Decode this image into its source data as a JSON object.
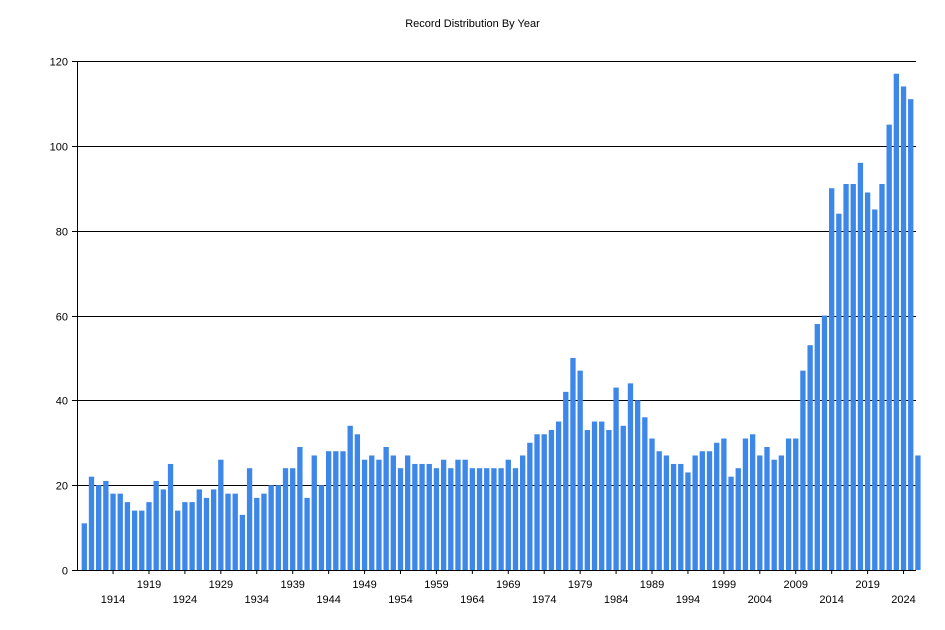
{
  "chart_data": {
    "type": "bar",
    "title": "Record Distribution By Year",
    "xlabel": "",
    "ylabel": "",
    "bar_color": "#3d87e8",
    "grid": "horizontal",
    "ylim": [
      0,
      120
    ],
    "yticks": [
      0,
      20,
      40,
      60,
      80,
      100,
      120
    ],
    "x_first_year": 1910,
    "x_tick_years": [
      1914,
      1919,
      1924,
      1929,
      1934,
      1939,
      1944,
      1949,
      1954,
      1959,
      1964,
      1969,
      1974,
      1979,
      1984,
      1989,
      1994,
      1999,
      2004,
      2009,
      2014,
      2019,
      2024
    ],
    "categories": [
      "1910",
      "1911",
      "1912",
      "1913",
      "1914",
      "1915",
      "1916",
      "1917",
      "1918",
      "1919",
      "1920",
      "1921",
      "1922",
      "1923",
      "1924",
      "1925",
      "1926",
      "1927",
      "1928",
      "1929",
      "1930",
      "1931",
      "1932",
      "1933",
      "1934",
      "1935",
      "1936",
      "1937",
      "1938",
      "1939",
      "1940",
      "1941",
      "1942",
      "1943",
      "1944",
      "1945",
      "1946",
      "1947",
      "1948",
      "1949",
      "1950",
      "1951",
      "1952",
      "1953",
      "1954",
      "1955",
      "1956",
      "1957",
      "1958",
      "1959",
      "1960",
      "1961",
      "1962",
      "1963",
      "1964",
      "1965",
      "1966",
      "1967",
      "1968",
      "1969",
      "1970",
      "1971",
      "1972",
      "1973",
      "1974",
      "1975",
      "1976",
      "1977",
      "1978",
      "1979",
      "1980",
      "1981",
      "1982",
      "1983",
      "1984",
      "1985",
      "1986",
      "1987",
      "1988",
      "1989",
      "1990",
      "1991",
      "1992",
      "1993",
      "1994",
      "1995",
      "1996",
      "1997",
      "1998",
      "1999",
      "2000",
      "2001",
      "2002",
      "2003",
      "2004",
      "2005",
      "2006",
      "2007",
      "2008",
      "2009",
      "2010",
      "2011",
      "2012",
      "2013",
      "2014",
      "2015",
      "2016",
      "2017",
      "2018",
      "2019",
      "2020",
      "2021",
      "2022",
      "2023",
      "2024",
      "2025"
    ],
    "values": [
      11,
      22,
      20,
      21,
      18,
      18,
      16,
      14,
      14,
      16,
      21,
      19,
      25,
      14,
      16,
      16,
      19,
      17,
      19,
      26,
      18,
      18,
      13,
      24,
      17,
      18,
      20,
      20,
      24,
      24,
      29,
      17,
      27,
      20,
      28,
      28,
      28,
      34,
      32,
      26,
      27,
      26,
      29,
      27,
      24,
      27,
      25,
      25,
      25,
      24,
      26,
      24,
      26,
      26,
      24,
      24,
      24,
      24,
      24,
      26,
      24,
      27,
      30,
      32,
      32,
      33,
      35,
      42,
      50,
      47,
      33,
      35,
      35,
      33,
      43,
      34,
      44,
      40,
      36,
      31,
      28,
      27,
      25,
      25,
      23,
      27,
      28,
      28,
      30,
      31,
      22,
      24,
      31,
      32,
      27,
      29,
      26,
      27,
      31,
      31,
      47,
      53,
      58,
      60,
      90,
      84,
      91,
      91,
      96,
      89,
      85,
      91,
      105,
      117,
      114,
      111,
      27
    ]
  }
}
